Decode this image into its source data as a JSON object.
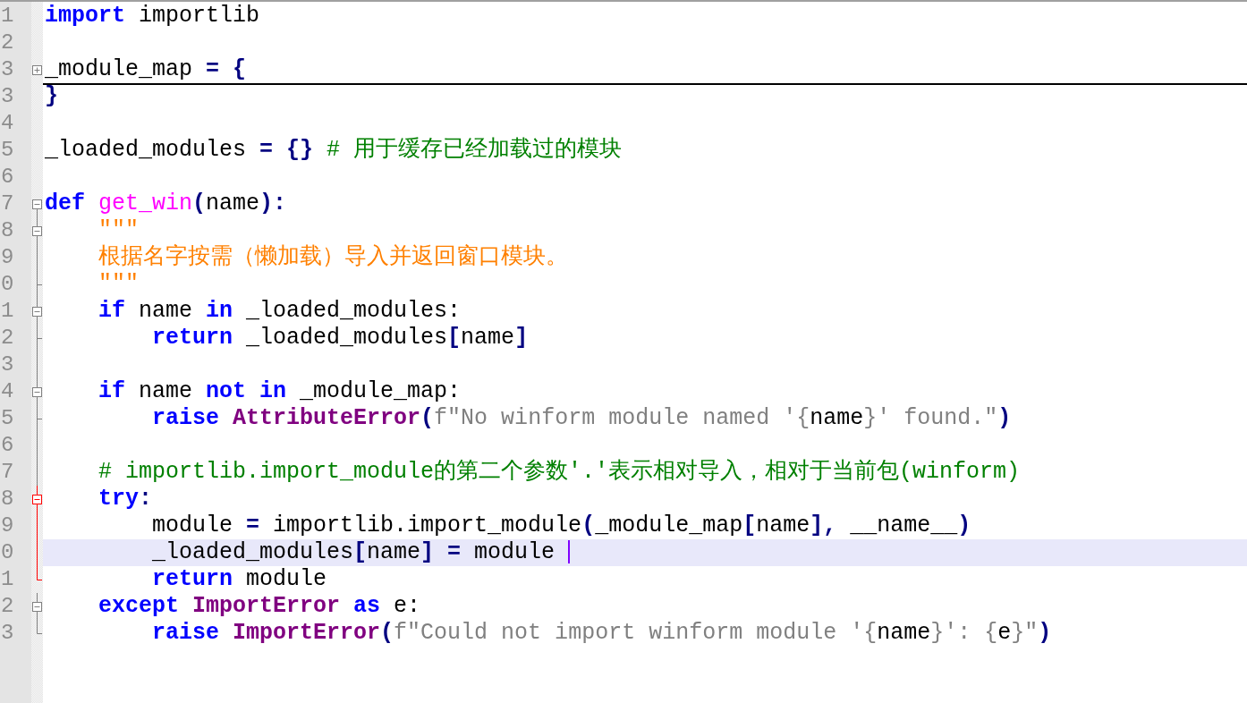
{
  "editor": {
    "lines": [
      {
        "number": "1",
        "current": false,
        "tokens": [
          {
            "kind": "keyword",
            "t": "import"
          },
          {
            "kind": "plain",
            "t": " importlib"
          }
        ]
      },
      {
        "number": "2",
        "current": false
      },
      {
        "number": "3",
        "fold": {
          "kind": "collapsed",
          "highlighted": false
        },
        "current": false,
        "tokens": [
          {
            "kind": "plain",
            "t": "_module_map "
          },
          {
            "kind": "operator",
            "t": "= {"
          }
        ]
      },
      {
        "number": "3",
        "current": false,
        "tokens": [
          {
            "kind": "operator",
            "t": "}"
          }
        ]
      },
      {
        "number": "4",
        "current": false
      },
      {
        "number": "5",
        "current": false,
        "tokens": [
          {
            "kind": "plain",
            "t": "_loaded_modules "
          },
          {
            "kind": "operator",
            "t": "= {}"
          },
          {
            "kind": "comment",
            "t": " # 用于缓存已经加载过的模块"
          }
        ]
      },
      {
        "number": "6",
        "current": false
      },
      {
        "number": "7",
        "fold": {
          "kind": "head",
          "highlighted": false
        },
        "current": false,
        "tokens": [
          {
            "kind": "keyword",
            "t": "def"
          },
          {
            "kind": "function",
            "t": " get_win"
          },
          {
            "kind": "operator",
            "t": "("
          },
          {
            "kind": "plain",
            "t": "name"
          },
          {
            "kind": "operator",
            "t": "):"
          }
        ]
      },
      {
        "number": "8",
        "fold": {
          "kind": "head",
          "highlighted": false
        },
        "current": false,
        "tokens": [
          {
            "kind": "docstring",
            "t": "    \"\"\""
          }
        ]
      },
      {
        "number": "9",
        "fold": {
          "kind": "body",
          "highlighted": false
        },
        "current": false,
        "tokens": [
          {
            "kind": "docstring",
            "t": "    根据名字按需（懒加载）导入并返回窗口模块。"
          }
        ]
      },
      {
        "number": "0",
        "fold": {
          "kind": "tail",
          "highlighted": false
        },
        "current": false,
        "tokens": [
          {
            "kind": "docstring",
            "t": "    \"\"\""
          }
        ]
      },
      {
        "number": "1",
        "fold": {
          "kind": "head",
          "highlighted": false
        },
        "current": false,
        "tokens": [
          {
            "kind": "keyword",
            "t": "    if"
          },
          {
            "kind": "plain",
            "t": " name "
          },
          {
            "kind": "keyword",
            "t": "in"
          },
          {
            "kind": "plain",
            "t": " _loaded_modules:"
          }
        ]
      },
      {
        "number": "2",
        "fold": {
          "kind": "tail",
          "highlighted": false
        },
        "current": false,
        "tokens": [
          {
            "kind": "keyword",
            "t": "        return"
          },
          {
            "kind": "plain",
            "t": " _loaded_modules"
          },
          {
            "kind": "operator",
            "t": "["
          },
          {
            "kind": "plain",
            "t": "name"
          },
          {
            "kind": "operator",
            "t": "]"
          }
        ]
      },
      {
        "number": "3",
        "fold": {
          "kind": "body",
          "highlighted": false
        },
        "current": false
      },
      {
        "number": "4",
        "fold": {
          "kind": "head",
          "highlighted": false
        },
        "current": false,
        "tokens": [
          {
            "kind": "keyword",
            "t": "    if"
          },
          {
            "kind": "plain",
            "t": " name "
          },
          {
            "kind": "keyword",
            "t": "not in"
          },
          {
            "kind": "plain",
            "t": " _module_map:"
          }
        ]
      },
      {
        "number": "5",
        "fold": {
          "kind": "tail",
          "highlighted": false
        },
        "current": false,
        "tokens": [
          {
            "kind": "keyword",
            "t": "        raise"
          },
          {
            "kind": "class",
            "t": " AttributeError"
          },
          {
            "kind": "operator",
            "t": "("
          },
          {
            "kind": "fstring",
            "t": "f\"No winform module named '{"
          },
          {
            "kind": "plain",
            "t": "name"
          },
          {
            "kind": "fstring",
            "t": "}' found.\""
          },
          {
            "kind": "operator",
            "t": ")"
          }
        ]
      },
      {
        "number": "6",
        "fold": {
          "kind": "body",
          "highlighted": false
        },
        "current": false
      },
      {
        "number": "7",
        "fold": {
          "kind": "body",
          "highlighted": false
        },
        "current": false,
        "tokens": [
          {
            "kind": "comment",
            "t": "    # importlib.import_module的第二个参数'.'表示相对导入，相对于当前包(winform)"
          }
        ]
      },
      {
        "number": "8",
        "fold": {
          "kind": "head",
          "highlighted": true
        },
        "current": false,
        "tokens": [
          {
            "kind": "keyword",
            "t": "    try"
          },
          {
            "kind": "operator",
            "t": ":"
          }
        ]
      },
      {
        "number": "9",
        "fold": {
          "kind": "body",
          "highlighted": true
        },
        "current": false,
        "tokens": [
          {
            "kind": "plain",
            "t": "        module "
          },
          {
            "kind": "operator",
            "t": "="
          },
          {
            "kind": "plain",
            "t": " importlib.import_module"
          },
          {
            "kind": "operator",
            "t": "("
          },
          {
            "kind": "plain",
            "t": "_module_map"
          },
          {
            "kind": "operator",
            "t": "["
          },
          {
            "kind": "plain",
            "t": "name"
          },
          {
            "kind": "operator",
            "t": "],"
          },
          {
            "kind": "plain",
            "t": " __name__"
          },
          {
            "kind": "operator",
            "t": ")"
          }
        ]
      },
      {
        "number": "0",
        "fold": {
          "kind": "body",
          "highlighted": true
        },
        "current": true,
        "tokens": [
          {
            "kind": "plain",
            "t": "        _loaded_modules"
          },
          {
            "kind": "operator",
            "t": "["
          },
          {
            "kind": "plain",
            "t": "name"
          },
          {
            "kind": "operator",
            "t": "] ="
          },
          {
            "kind": "plain",
            "t": " module"
          }
        ]
      },
      {
        "number": "1",
        "fold": {
          "kind": "tail",
          "highlighted": true
        },
        "current": false,
        "tokens": [
          {
            "kind": "keyword",
            "t": "        return"
          },
          {
            "kind": "plain",
            "t": " module"
          }
        ]
      },
      {
        "number": "2",
        "fold": {
          "kind": "head",
          "highlighted": false
        },
        "current": false,
        "tokens": [
          {
            "kind": "keyword",
            "t": "    except"
          },
          {
            "kind": "class",
            "t": " ImportError"
          },
          {
            "kind": "keyword",
            "t": " as"
          },
          {
            "kind": "plain",
            "t": " e:"
          }
        ]
      },
      {
        "number": "3",
        "fold": {
          "kind": "tail",
          "highlighted": false
        },
        "current": false,
        "tokens": [
          {
            "kind": "keyword",
            "t": "        raise"
          },
          {
            "kind": "class",
            "t": " ImportError"
          },
          {
            "kind": "operator",
            "t": "("
          },
          {
            "kind": "fstring",
            "t": "f\"Could not import winform module '{"
          },
          {
            "kind": "plain",
            "t": "name"
          },
          {
            "kind": "fstring",
            "t": "}': {"
          },
          {
            "kind": "plain",
            "t": "e"
          },
          {
            "kind": "fstring",
            "t": "}\""
          },
          {
            "kind": "operator",
            "t": ")"
          }
        ]
      }
    ]
  }
}
